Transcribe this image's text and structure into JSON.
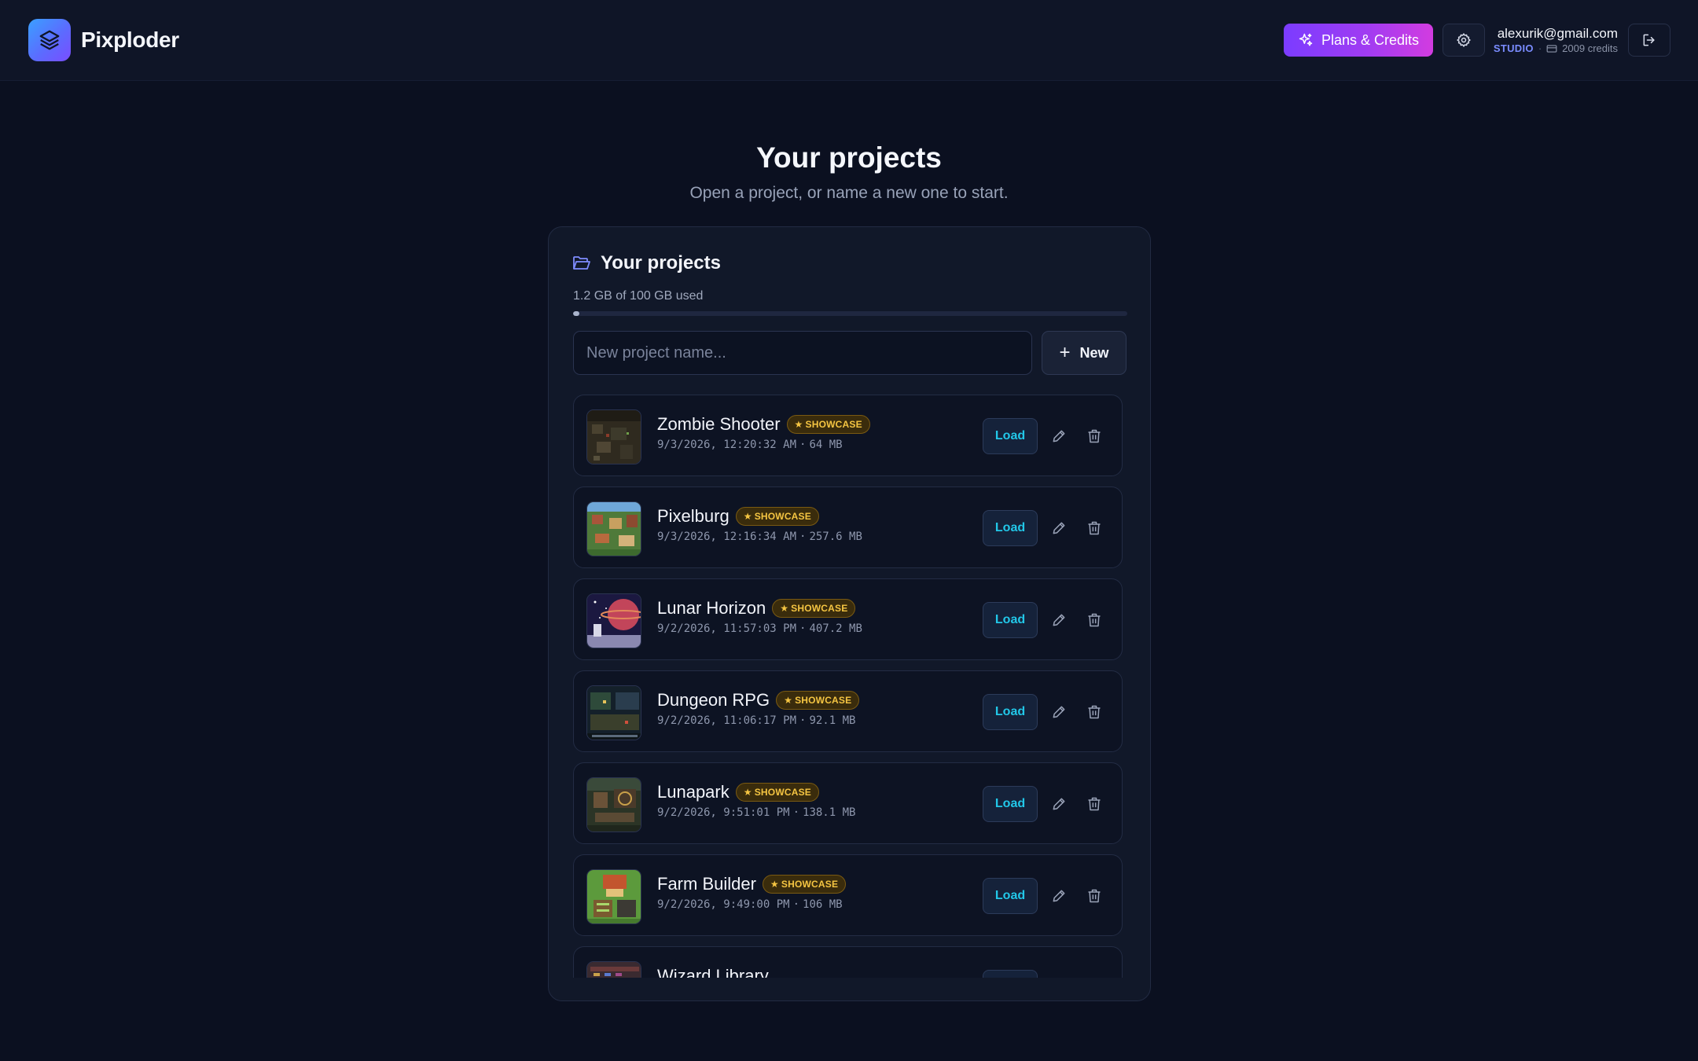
{
  "app": {
    "name": "Pixploder",
    "logo_icon": "layers-icon"
  },
  "header": {
    "plans_label": "Plans & Credits",
    "settings_icon": "gear-icon",
    "user_email": "alexurik@gmail.com",
    "user_plan": "STUDIO",
    "credits_label": "2009 credits",
    "logout_icon": "logout-icon"
  },
  "main": {
    "title": "Your projects",
    "subtitle": "Open a project, or name a new one to start."
  },
  "panel": {
    "title": "Your projects",
    "storage_label": "1.2 GB of 100 GB used",
    "storage_used_fraction": 0.012,
    "new_input_placeholder": "New project name...",
    "new_button_label": "New"
  },
  "projects": [
    {
      "name": "Zombie Shooter",
      "badge": "SHOWCASE",
      "date": "9/3/2026, 12:20:32 AM",
      "size": "64 MB",
      "load_label": "Load"
    },
    {
      "name": "Pixelburg",
      "badge": "SHOWCASE",
      "date": "9/3/2026, 12:16:34 AM",
      "size": "257.6 MB",
      "load_label": "Load"
    },
    {
      "name": "Lunar Horizon",
      "badge": "SHOWCASE",
      "date": "9/2/2026, 11:57:03 PM",
      "size": "407.2 MB",
      "load_label": "Load"
    },
    {
      "name": "Dungeon RPG",
      "badge": "SHOWCASE",
      "date": "9/2/2026, 11:06:17 PM",
      "size": "92.1 MB",
      "load_label": "Load"
    },
    {
      "name": "Lunapark",
      "badge": "SHOWCASE",
      "date": "9/2/2026, 9:51:01 PM",
      "size": "138.1 MB",
      "load_label": "Load"
    },
    {
      "name": "Farm Builder",
      "badge": "SHOWCASE",
      "date": "9/2/2026, 9:49:00 PM",
      "size": "106 MB",
      "load_label": "Load"
    },
    {
      "name": "Wizard Library",
      "badge": "",
      "date": "",
      "size": "",
      "load_label": ""
    }
  ],
  "colors": {
    "background": "#0b1020",
    "panel": "#111829",
    "accent_load": "#22c7e8",
    "badge_gold": "#f5c542",
    "plans_gradient_start": "#7b3cff",
    "plans_gradient_end": "#d23ce0",
    "plan_label": "#7a8cff"
  }
}
